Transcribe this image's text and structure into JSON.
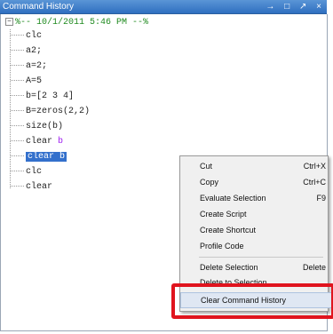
{
  "window": {
    "title": "Command History",
    "controls": "→ □ ↗ ×"
  },
  "history": {
    "expander": "−",
    "session_label": "%-- 10/1/2011 5:46 PM --%",
    "commands": [
      {
        "text": "clc"
      },
      {
        "text": "a2;"
      },
      {
        "text": "a=2;"
      },
      {
        "text": "A=5"
      },
      {
        "text": "b=[2 3 4]"
      },
      {
        "text": "B=zeros(2,2)"
      },
      {
        "text": "size(b)"
      },
      {
        "text": "clear ",
        "kw": "b"
      },
      {
        "text": "clear ",
        "kw": "b",
        "selected": true
      },
      {
        "text": "clc"
      },
      {
        "text": "clear"
      }
    ]
  },
  "context_menu": {
    "items": [
      {
        "label": "Cut",
        "shortcut": "Ctrl+X"
      },
      {
        "label": "Copy",
        "shortcut": "Ctrl+C"
      },
      {
        "label": "Evaluate Selection",
        "shortcut": "F9"
      },
      {
        "label": "Create Script",
        "shortcut": ""
      },
      {
        "label": "Create Shortcut",
        "shortcut": ""
      },
      {
        "label": "Profile Code",
        "shortcut": ""
      },
      {
        "label": "Delete Selection",
        "shortcut": "Delete"
      },
      {
        "label": "Delete to Selection",
        "shortcut": ""
      },
      {
        "label": "Clear Command History",
        "shortcut": ""
      }
    ]
  },
  "colors": {
    "titlebar": "#2f6fc0",
    "selection": "#3370cc",
    "keyword": "#a020f0",
    "session_label": "#1f8a1f",
    "highlight_box": "#e0141e"
  }
}
